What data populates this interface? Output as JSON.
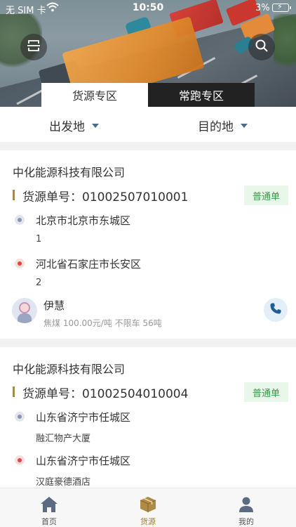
{
  "status_bar": {
    "carrier": "无 SIM 卡",
    "time": "10:50",
    "battery": "3%"
  },
  "segments": {
    "active": "货源专区",
    "inactive": "常跑专区"
  },
  "filters": {
    "origin": "出发地",
    "destination": "目的地"
  },
  "listings": [
    {
      "company": "中化能源科技有限公司",
      "order_no": "货源单号：01002507010001",
      "badge": "普通单",
      "from_place": "北京市北京市东城区",
      "from_detail": "1",
      "to_place": "河北省石家庄市长安区",
      "to_detail": "2",
      "contact_name": "伊慧",
      "cargo_info": "焦煤 100.00元/吨 不限车 56吨"
    },
    {
      "company": "中化能源科技有限公司",
      "order_no": "货源单号：01002504010004",
      "badge": "普通单",
      "from_place": "山东省济宁市任城区",
      "from_detail": "融汇物产大厦",
      "to_place": "山东省济宁市任城区",
      "to_detail": "汉庭豪德酒店"
    }
  ],
  "tabbar": {
    "home": "首页",
    "goods": "货源",
    "mine": "我的"
  },
  "colors": {
    "accent": "#a07a34",
    "badge_text": "#3a9a45",
    "badge_bg": "#e9f7ea",
    "origin_dot": "#8b93b3",
    "dest_dot": "#e0463e"
  }
}
